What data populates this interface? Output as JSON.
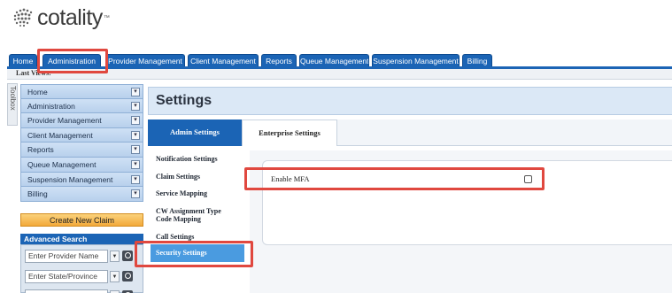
{
  "brand": {
    "name": "cotality",
    "tm": "™"
  },
  "tabs": [
    "Home",
    "Administration",
    "Provider Management",
    "Client Management",
    "Reports",
    "Queue Management",
    "Suspension Management",
    "Billing"
  ],
  "last_views_label": "Last Views:",
  "toolbox_label": "Toolbox",
  "sidebar": {
    "items": [
      "Home",
      "Administration",
      "Provider Management",
      "Client Management",
      "Reports",
      "Queue Management",
      "Suspension Management",
      "Billing"
    ]
  },
  "create_claim_label": "Create New Claim",
  "advanced_search": {
    "title": "Advanced Search",
    "provider_placeholder": "Enter Provider Name",
    "state_placeholder": "Enter State/Province"
  },
  "settings": {
    "title": "Settings",
    "tabs": [
      "Admin Settings",
      "Enterprise Settings"
    ],
    "nav": [
      "Notification Settings",
      "Claim Settings",
      "Service Mapping",
      "CW Assignment Type Code Mapping",
      "Call Settings",
      "Security Settings"
    ],
    "mfa_label": "Enable MFA",
    "mfa_enabled": false
  },
  "colors": {
    "tab_blue": "#1b64b5",
    "highlight": "#e0483f",
    "active_nav": "#4a9be0",
    "create_button": "#f2a93b"
  }
}
